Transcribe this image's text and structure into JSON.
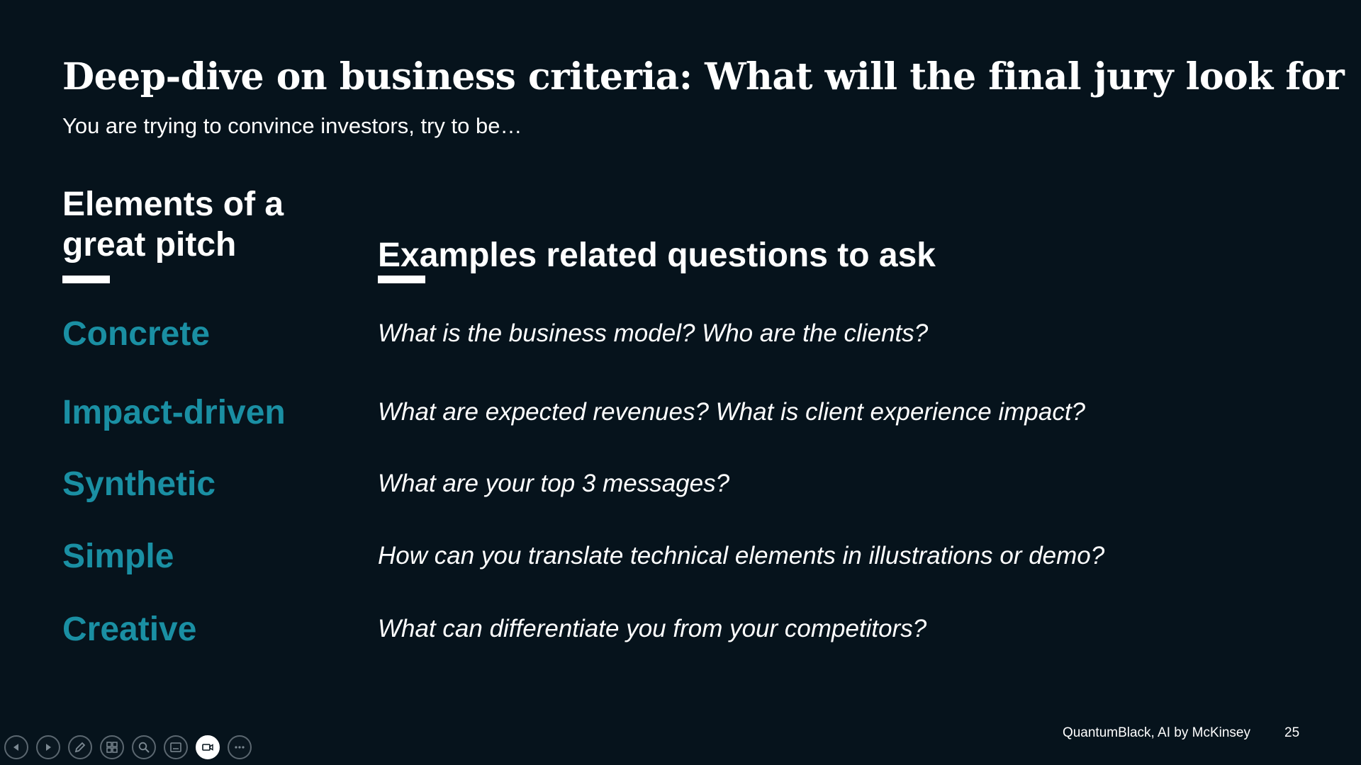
{
  "slide": {
    "title": "Deep-dive on business criteria: What will the final jury look for",
    "subtitle": "You are trying to convince investors, try to be…",
    "left_heading": "Elements of a great pitch",
    "right_heading": "Examples related questions to ask",
    "rows": [
      {
        "element": "Concrete",
        "question": "What is the business model? Who are the clients?"
      },
      {
        "element": "Impact-driven",
        "question": "What are expected revenues? What is client experience impact?"
      },
      {
        "element": "Synthetic",
        "question": "What are your top 3 messages?"
      },
      {
        "element": "Simple",
        "question": "How can you translate technical elements in illustrations or demo?"
      },
      {
        "element": "Creative",
        "question": "What can differentiate you from your competitors?"
      }
    ],
    "footer_brand": "QuantumBlack, AI by McKinsey",
    "page_number": "25"
  },
  "colors": {
    "background": "#06131c",
    "accent": "#1a8fa3",
    "text": "#ffffff"
  },
  "toolbar": {
    "buttons": [
      {
        "icon": "previous-icon"
      },
      {
        "icon": "next-icon"
      },
      {
        "icon": "pen-icon"
      },
      {
        "icon": "slides-grid-icon"
      },
      {
        "icon": "zoom-icon"
      },
      {
        "icon": "subtitles-icon"
      },
      {
        "icon": "camera-icon",
        "active": true
      },
      {
        "icon": "more-options-icon"
      }
    ]
  }
}
